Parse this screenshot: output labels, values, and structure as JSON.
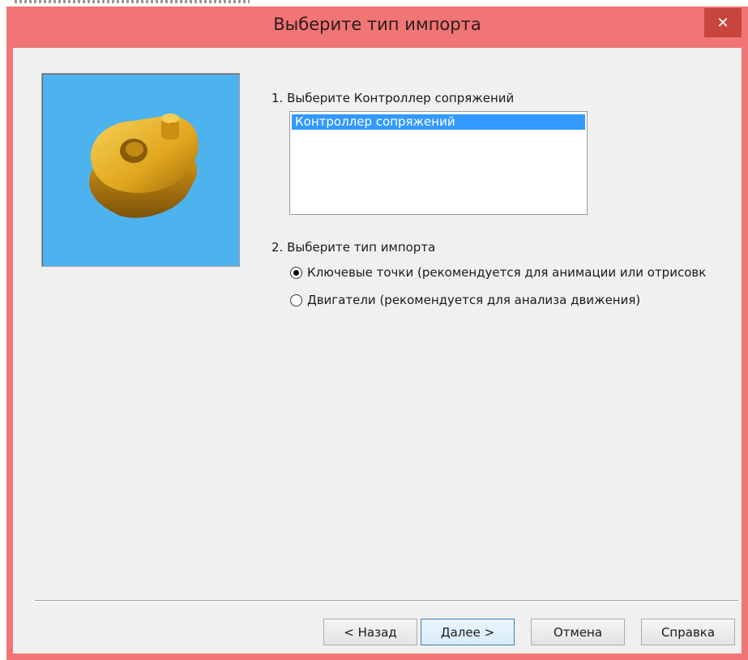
{
  "window": {
    "title": "Выберите тип импорта",
    "close_glyph": "✕"
  },
  "section1": {
    "label": "1. Выберите Контроллер сопряжений",
    "list_items": [
      "Контроллер сопряжений"
    ],
    "selected_index": 0
  },
  "section2": {
    "label": "2. Выберите тип импорта",
    "options": [
      {
        "label": "Ключевые точки (рекомендуется для анимации или отрисовк",
        "checked": true
      },
      {
        "label": "Двигатели (рекомендуется для анализа движения)",
        "checked": false
      }
    ]
  },
  "buttons": {
    "back": "< Назад",
    "next": "Далее >",
    "cancel": "Отмена",
    "help": "Справка"
  },
  "colors": {
    "titlebar": "#f07574",
    "close_button": "#c8453f",
    "preview_background": "#4db3ef",
    "selection": "#3399ff",
    "part": "#e6b020"
  },
  "icons": {
    "preview": "yellow-mechanical-part-image",
    "close": "close-icon"
  }
}
